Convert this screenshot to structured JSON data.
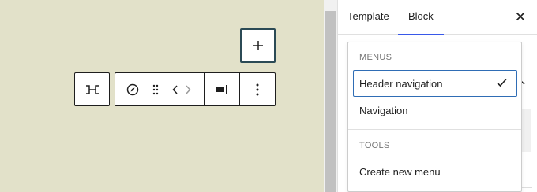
{
  "canvas": {
    "background": "#e2e1c9",
    "add_block_icon": "plus-icon",
    "toolbar": {
      "parent_icon": "parent-block-icon",
      "navigation_icon": "compass-icon",
      "drag_icon": "drag-handle-icon",
      "move_left_icon": "chevron-left-icon",
      "move_right_icon": "chevron-right-icon",
      "justify_icon": "justify-right-icon",
      "more_icon": "more-vertical-icon"
    }
  },
  "sidebar": {
    "tabs": [
      {
        "label": "Template",
        "active": false
      },
      {
        "label": "Block",
        "active": true
      }
    ],
    "close_icon": "close-icon",
    "accent": "#3858e9"
  },
  "menu": {
    "sections": [
      {
        "heading": "MENUS",
        "items": [
          {
            "label": "Header navigation",
            "selected": true
          },
          {
            "label": "Navigation",
            "selected": false
          }
        ]
      },
      {
        "heading": "TOOLS",
        "items": [
          {
            "label": "Create new menu",
            "selected": false
          }
        ]
      }
    ],
    "check_icon": "check-icon",
    "selected_border": "#2f6db5"
  }
}
